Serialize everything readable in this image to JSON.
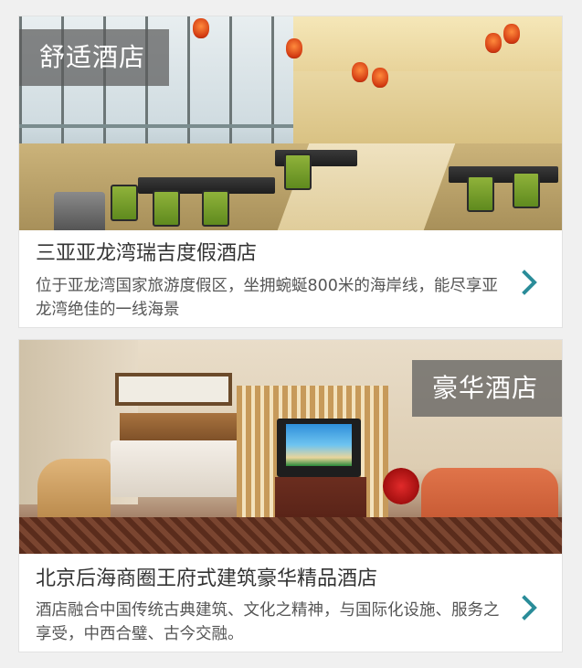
{
  "cards": [
    {
      "tag": "舒适酒店",
      "title": "三亚亚龙湾瑞吉度假酒店",
      "description": "位于亚龙湾国家旅游度假区，坐拥蜿蜒800米的海岸线，能尽享亚龙湾绝佳的一线海景"
    },
    {
      "tag": "豪华酒店",
      "title": "北京后海商圈王府式建筑豪华精品酒店",
      "description": "酒店融合中国传统古典建筑、文化之精神，与国际化设施、服务之享受，中西合璧、古今交融。"
    }
  ],
  "colors": {
    "accent_chevron": "#2a8c99",
    "tag_background": "rgba(90,90,90,0.72)",
    "title_text": "#333333",
    "description_text": "#555555"
  },
  "icons": {
    "chevron": "chevron-right-icon"
  }
}
